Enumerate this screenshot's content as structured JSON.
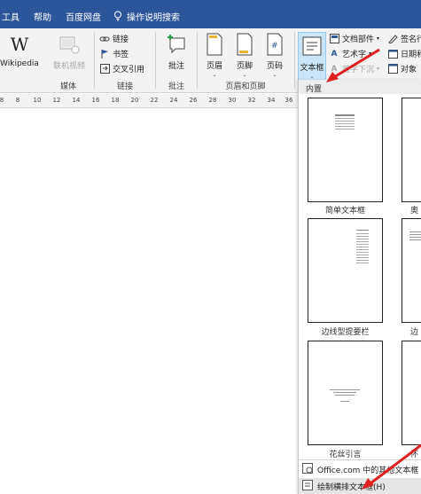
{
  "menubar": {
    "items": [
      "工具",
      "帮助",
      "百度网盘"
    ],
    "tell_me": "操作说明搜索"
  },
  "ribbon": {
    "media": {
      "wikipedia": "Wikipedia",
      "online_video": "联机视频",
      "group": "媒体"
    },
    "links": {
      "link": "链接",
      "bookmark": "书签",
      "crossref": "交叉引用",
      "group": "链接"
    },
    "comments": {
      "comment": "批注",
      "group": "批注"
    },
    "header_footer": {
      "header": "页眉",
      "footer": "页脚",
      "page_number": "页码",
      "group": "页眉和页脚"
    },
    "text": {
      "textbox": "文本框",
      "quick_parts": "文档部件",
      "wordart": "艺术字",
      "dropcap": "首字下沉",
      "signature": "签名行",
      "datetime": "日期和",
      "object": "对象"
    }
  },
  "ruler": {
    "ticks": [
      "8",
      "8",
      "10",
      "12",
      "14",
      "16",
      "18",
      "20",
      "22",
      "24",
      "26",
      "28",
      "30",
      "32",
      "34",
      "36"
    ]
  },
  "gallery": {
    "section": "内置",
    "items": [
      {
        "label": "简单文本框"
      },
      {
        "label": "奥"
      },
      {
        "label": "边线型提要栏"
      },
      {
        "label": "边"
      },
      {
        "label": "花丝引言"
      },
      {
        "label": "怀"
      }
    ],
    "office_more": "Office.com 中的其他文本框",
    "draw_horizontal": "绘制横排文本框(H)"
  },
  "colors": {
    "brand": "#2b579a",
    "annotation": "#e02020"
  }
}
